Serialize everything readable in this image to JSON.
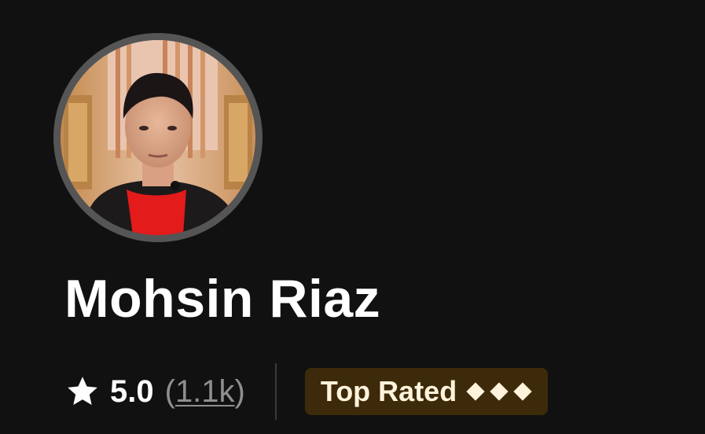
{
  "seller": {
    "name": "Mohsin Riaz",
    "rating": "5.0",
    "reviews_open": "(",
    "reviews_count": "1.1k",
    "reviews_close": ")",
    "badge_label": "Top Rated",
    "badge_level": 3
  },
  "icons": {
    "rating": "star-icon",
    "badge": "diamond-icon"
  },
  "colors": {
    "background": "#111111",
    "text": "#ffffff",
    "muted_text": "#8f8f8f",
    "badge_bg": "#3d2a0a",
    "badge_text": "#fff3dc",
    "avatar_ring": "#555555"
  }
}
